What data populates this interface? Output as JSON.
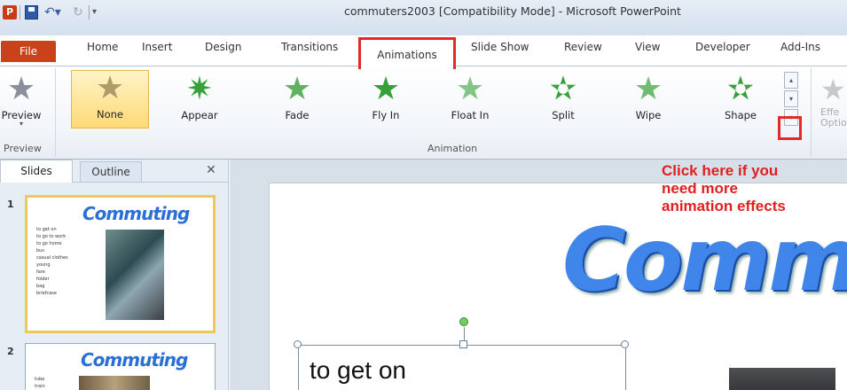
{
  "titlebar": {
    "app_icon_letter": "P",
    "window_title": "commuters2003 [Compatibility Mode] - Microsoft PowerPoint"
  },
  "tabs": {
    "file": "File",
    "home": "Home",
    "insert": "Insert",
    "design": "Design",
    "transitions": "Transitions",
    "animations": "Animations",
    "slide_show": "Slide Show",
    "review": "Review",
    "view": "View",
    "developer": "Developer",
    "add_ins": "Add-Ins",
    "active": "Animations"
  },
  "ribbon": {
    "preview_label": "Preview",
    "preview_group": "Preview",
    "animation_group": "Animation",
    "effects": [
      {
        "label": "None"
      },
      {
        "label": "Appear"
      },
      {
        "label": "Fade"
      },
      {
        "label": "Fly In"
      },
      {
        "label": "Float In"
      },
      {
        "label": "Split"
      },
      {
        "label": "Wipe"
      },
      {
        "label": "Shape"
      }
    ],
    "selected_effect": "None",
    "effect_options_line1": "Effe",
    "effect_options_line2": "Optio"
  },
  "slides_panel": {
    "tab_slides": "Slides",
    "tab_outline": "Outline",
    "slides": [
      {
        "number": "1",
        "title": "Commuting",
        "items": [
          "to get on",
          "to go to work",
          "to go home",
          "bus",
          "casual clothes",
          "young",
          "fare",
          "folder",
          "bag",
          "briefcase"
        ]
      },
      {
        "number": "2",
        "title": "Commuting",
        "items": [
          "tube",
          "train"
        ]
      }
    ]
  },
  "slide": {
    "title": "Comm",
    "text_box": "to get on"
  },
  "annotation": "Click here if you\nneed more\nanimation effects",
  "colors": {
    "annotation_red": "#e02020",
    "file_tab": "#c9421a",
    "title_blue": "#3f85ea",
    "highlight_red": "#e12a2a"
  }
}
